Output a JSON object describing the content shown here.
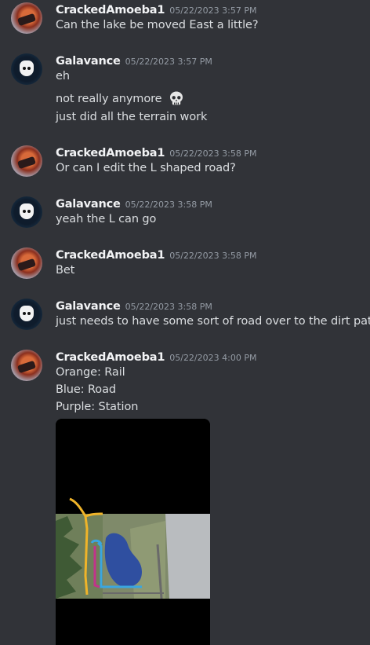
{
  "messages": [
    {
      "author": "CrackedAmoeba1",
      "timestamp": "05/22/2023 3:57 PM",
      "lines": [
        "Can the lake be moved East a little?"
      ]
    },
    {
      "author": "Galavance",
      "timestamp": "05/22/2023 3:57 PM",
      "lines": [
        "eh",
        "not really anymore",
        "just did all the terrain work"
      ]
    },
    {
      "author": "CrackedAmoeba1",
      "timestamp": "05/22/2023 3:58 PM",
      "lines": [
        "Or can I edit the L shaped road?"
      ]
    },
    {
      "author": "Galavance",
      "timestamp": "05/22/2023 3:58 PM",
      "lines": [
        "yeah the L can go"
      ]
    },
    {
      "author": "CrackedAmoeba1",
      "timestamp": "05/22/2023 3:58 PM",
      "lines": [
        "Bet"
      ]
    },
    {
      "author": "Galavance",
      "timestamp": "05/22/2023 3:58 PM",
      "lines": [
        "just needs to have some sort of road over to the dirt path"
      ]
    },
    {
      "author": "CrackedAmoeba1",
      "timestamp": "05/22/2023 4:00 PM",
      "lines": [
        "Orange: Rail",
        "Blue: Road",
        "Purple: Station"
      ]
    }
  ],
  "icons": {
    "skull_emoji": "skull-icon"
  },
  "colors": {
    "background": "#313338",
    "rail": "#f0b429",
    "road": "#3aa6e0",
    "station": "#c0348a",
    "lake": "#2f4fa0"
  }
}
